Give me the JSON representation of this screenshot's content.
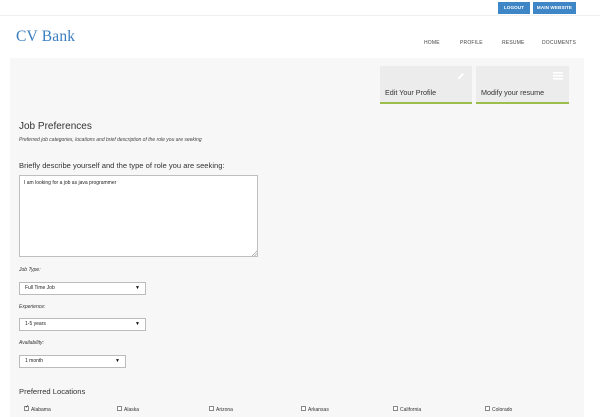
{
  "topbar": {
    "logout_label": "LOGOUT",
    "main_website_label": "MAIN WEBSITE"
  },
  "header": {
    "logo": "CV Bank",
    "nav": [
      "HOME",
      "PROFILE",
      "RESUME",
      "DOCUMENTS"
    ]
  },
  "cards": {
    "edit_profile": "Edit Your Profile",
    "modify_resume": "Modify your resume"
  },
  "job_preferences": {
    "title": "Job Preferences",
    "subtitle": "Preferred job categories, locations and brief description of the role you are seeking",
    "describe_label": "Briefly describe yourself and the type of role you are seeking:",
    "describe_value": "I am looking for a job as java programmer",
    "job_type_label": "Job Type:",
    "job_type_value": "Full Time Job",
    "experience_label": "Experience:",
    "experience_value": "1-5 years",
    "availability_label": "Availability:",
    "availability_value": "1 month"
  },
  "locations": {
    "title": "Preferred Locations",
    "items": [
      {
        "label": "Alabama",
        "checked": true
      },
      {
        "label": "Alaska",
        "checked": false
      },
      {
        "label": "Arizona",
        "checked": false
      },
      {
        "label": "Arkansas",
        "checked": false
      },
      {
        "label": "California",
        "checked": false
      },
      {
        "label": "Colorado",
        "checked": false
      }
    ]
  },
  "colors": {
    "accent": "#3f86c7",
    "logo": "#3a7dbf",
    "card_underline": "#9bbf4a",
    "content_bg": "#f7f7f7"
  }
}
